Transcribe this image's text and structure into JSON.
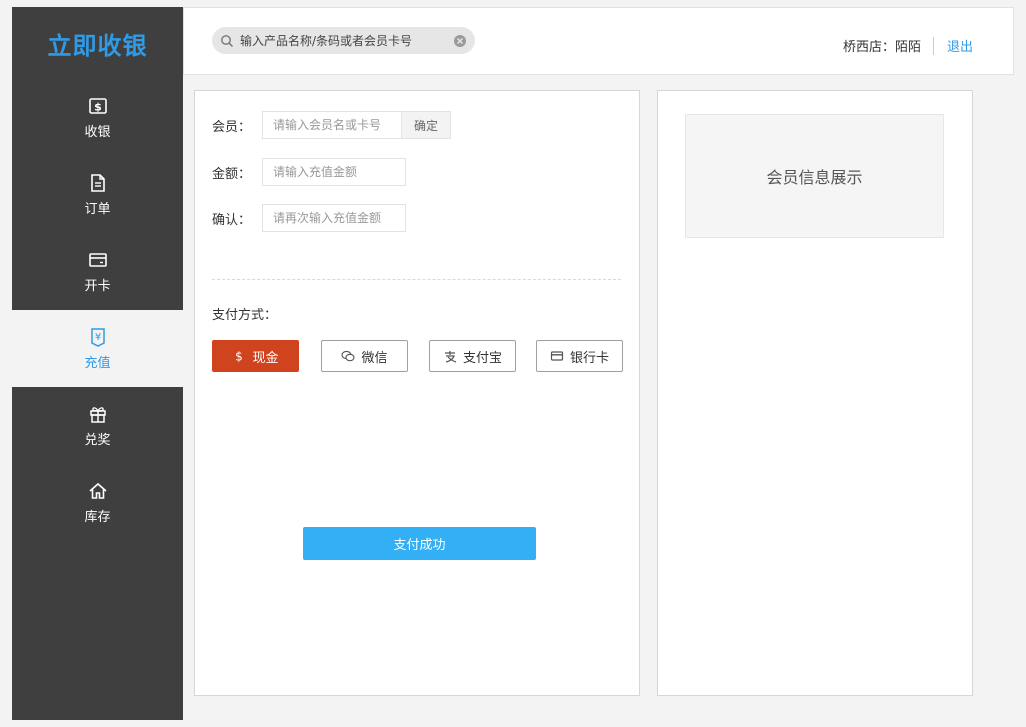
{
  "brand": "立即收银",
  "sidebar": {
    "items": [
      {
        "label": "收银",
        "icon": "cash-icon"
      },
      {
        "label": "订单",
        "icon": "document-icon"
      },
      {
        "label": "开卡",
        "icon": "card-icon"
      },
      {
        "label": "充值",
        "icon": "yen-icon",
        "active": true
      },
      {
        "label": "兑奖",
        "icon": "gift-icon"
      },
      {
        "label": "库存",
        "icon": "home-icon"
      }
    ]
  },
  "header": {
    "search_placeholder": "输入产品名称/条码或者会员卡号",
    "store_label": "桥西店：陌陌",
    "logout": "退出"
  },
  "form": {
    "member_label": "会员：",
    "member_placeholder": "请输入会员名或卡号",
    "confirm_label": "确定",
    "amount_label": "金额：",
    "amount_placeholder": "请输入充值金额",
    "confirm_amount_label": "确认：",
    "confirm_amount_placeholder": "请再次输入充值金额",
    "pay_method_label": "支付方式：",
    "pay_methods": [
      {
        "label": "现金",
        "icon": "dollar-icon",
        "active": true
      },
      {
        "label": "微信",
        "icon": "wechat-icon"
      },
      {
        "label": "支付宝",
        "icon": "alipay-icon"
      },
      {
        "label": "银行卡",
        "icon": "bankcard-icon"
      }
    ],
    "submit_label": "支付成功"
  },
  "member_info": {
    "placeholder": "会员信息展示"
  },
  "colors": {
    "sidebar_bg": "#3f3f3f",
    "accent": "#2f9be6",
    "cash_active": "#d0431f",
    "submit": "#33b0f5"
  }
}
